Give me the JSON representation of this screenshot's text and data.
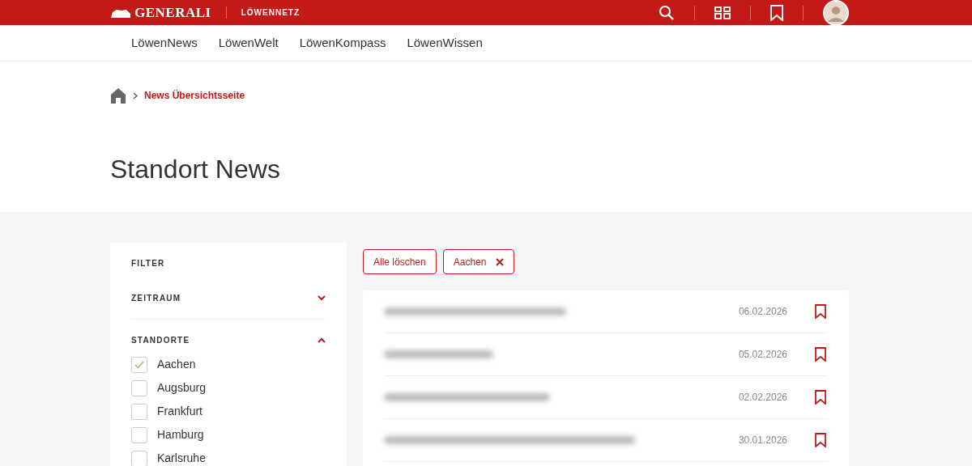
{
  "header": {
    "logo": "GENERALI",
    "portal": "LÖWENNETZ"
  },
  "nav": [
    {
      "label": "LöwenNews"
    },
    {
      "label": "LöwenWelt"
    },
    {
      "label": "LöwenKompass"
    },
    {
      "label": "LöwenWissen"
    }
  ],
  "breadcrumb": {
    "current": "News Übersichtsseite"
  },
  "page_title": "Standort News",
  "filter": {
    "heading": "FILTER",
    "sections": [
      {
        "label": "ZEITRAUM",
        "expanded": false
      },
      {
        "label": "STANDORTE",
        "expanded": true,
        "options": [
          {
            "label": "Aachen",
            "checked": true
          },
          {
            "label": "Augsburg",
            "checked": false
          },
          {
            "label": "Frankfurt",
            "checked": false
          },
          {
            "label": "Hamburg",
            "checked": false
          },
          {
            "label": "Karlsruhe",
            "checked": false
          }
        ]
      }
    ]
  },
  "chips": [
    {
      "kind": "clear",
      "label": "Alle löschen"
    },
    {
      "kind": "tag",
      "label": "Aachen"
    }
  ],
  "news": [
    {
      "date": "06.02.2026",
      "bookmarked": false
    },
    {
      "date": "05.02.2026",
      "bookmarked": false
    },
    {
      "date": "02.02.2026",
      "bookmarked": false
    },
    {
      "date": "30.01.2026",
      "bookmarked": false
    }
  ]
}
